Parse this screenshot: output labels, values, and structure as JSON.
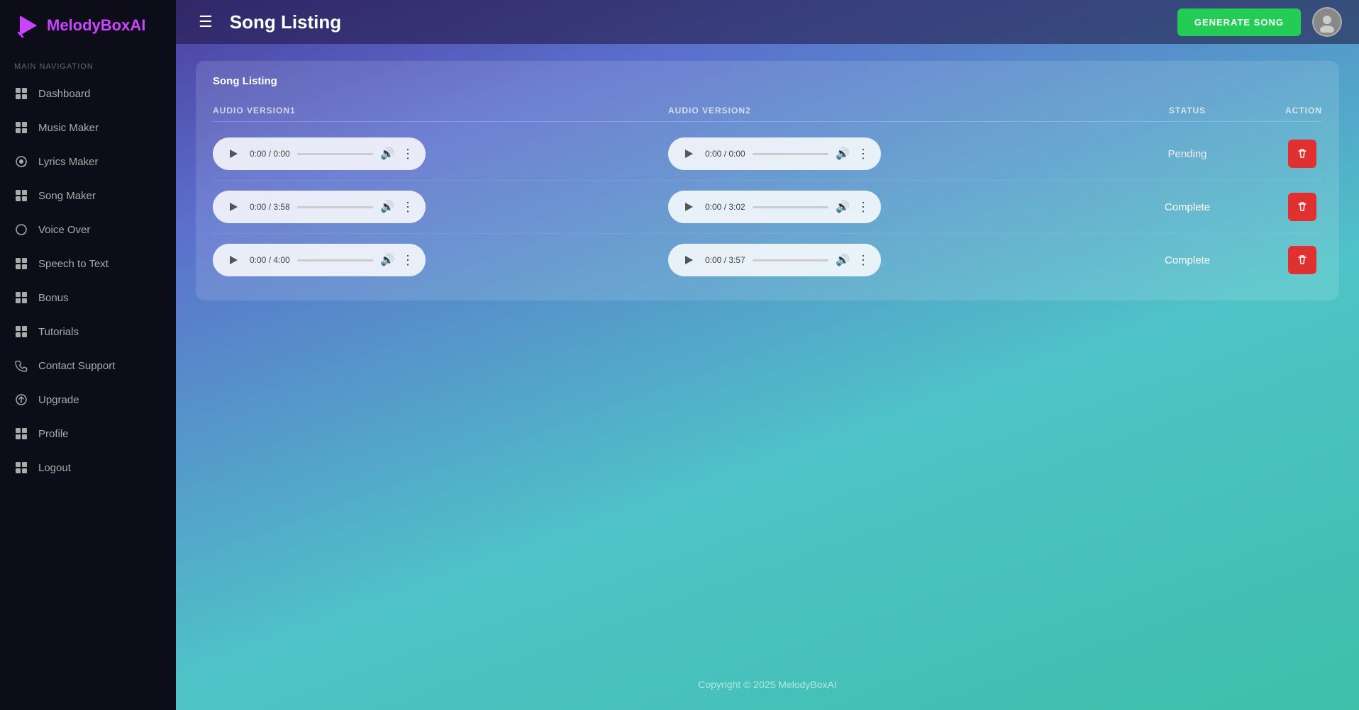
{
  "app": {
    "name": "MelodyBox",
    "name_highlight": "AI",
    "logo_symbol": "♪"
  },
  "sidebar": {
    "nav_label": "MAIN NAVIGATION",
    "items": [
      {
        "id": "dashboard",
        "label": "Dashboard",
        "icon": "grid"
      },
      {
        "id": "music-maker",
        "label": "Music Maker",
        "icon": "music"
      },
      {
        "id": "lyrics-maker",
        "label": "Lyrics Maker",
        "icon": "at"
      },
      {
        "id": "song-maker",
        "label": "Song Maker",
        "icon": "grid"
      },
      {
        "id": "voice-over",
        "label": "Voice Over",
        "icon": "circle"
      },
      {
        "id": "speech-to-text",
        "label": "Speech to Text",
        "icon": "grid"
      },
      {
        "id": "bonus",
        "label": "Bonus",
        "icon": "grid"
      },
      {
        "id": "tutorials",
        "label": "Tutorials",
        "icon": "grid"
      },
      {
        "id": "contact-support",
        "label": "Contact Support",
        "icon": "phone"
      },
      {
        "id": "upgrade",
        "label": "Upgrade",
        "icon": "arrow"
      },
      {
        "id": "profile",
        "label": "Profile",
        "icon": "grid"
      },
      {
        "id": "logout",
        "label": "Logout",
        "icon": "grid"
      }
    ]
  },
  "topbar": {
    "page_title": "Song Listing",
    "generate_btn_label": "GENERATE SONG"
  },
  "content": {
    "card_title": "Song Listing",
    "table": {
      "columns": [
        "AUDIO VERSION1",
        "AUDIO VERSION2",
        "STATUS",
        "ACTION"
      ],
      "rows": [
        {
          "audio1": {
            "time": "0:00 / 0:00",
            "progress": 0
          },
          "audio2": {
            "time": "0:00 / 0:00",
            "progress": 0
          },
          "status": "Pending"
        },
        {
          "audio1": {
            "time": "0:00 / 3:58",
            "progress": 0
          },
          "audio2": {
            "time": "0:00 / 3:02",
            "progress": 0
          },
          "status": "Complete"
        },
        {
          "audio1": {
            "time": "0:00 / 4:00",
            "progress": 0
          },
          "audio2": {
            "time": "0:00 / 3:57",
            "progress": 0
          },
          "status": "Complete"
        }
      ]
    }
  },
  "footer": {
    "copyright": "Copyright © 2025 MelodyBoxAI"
  }
}
